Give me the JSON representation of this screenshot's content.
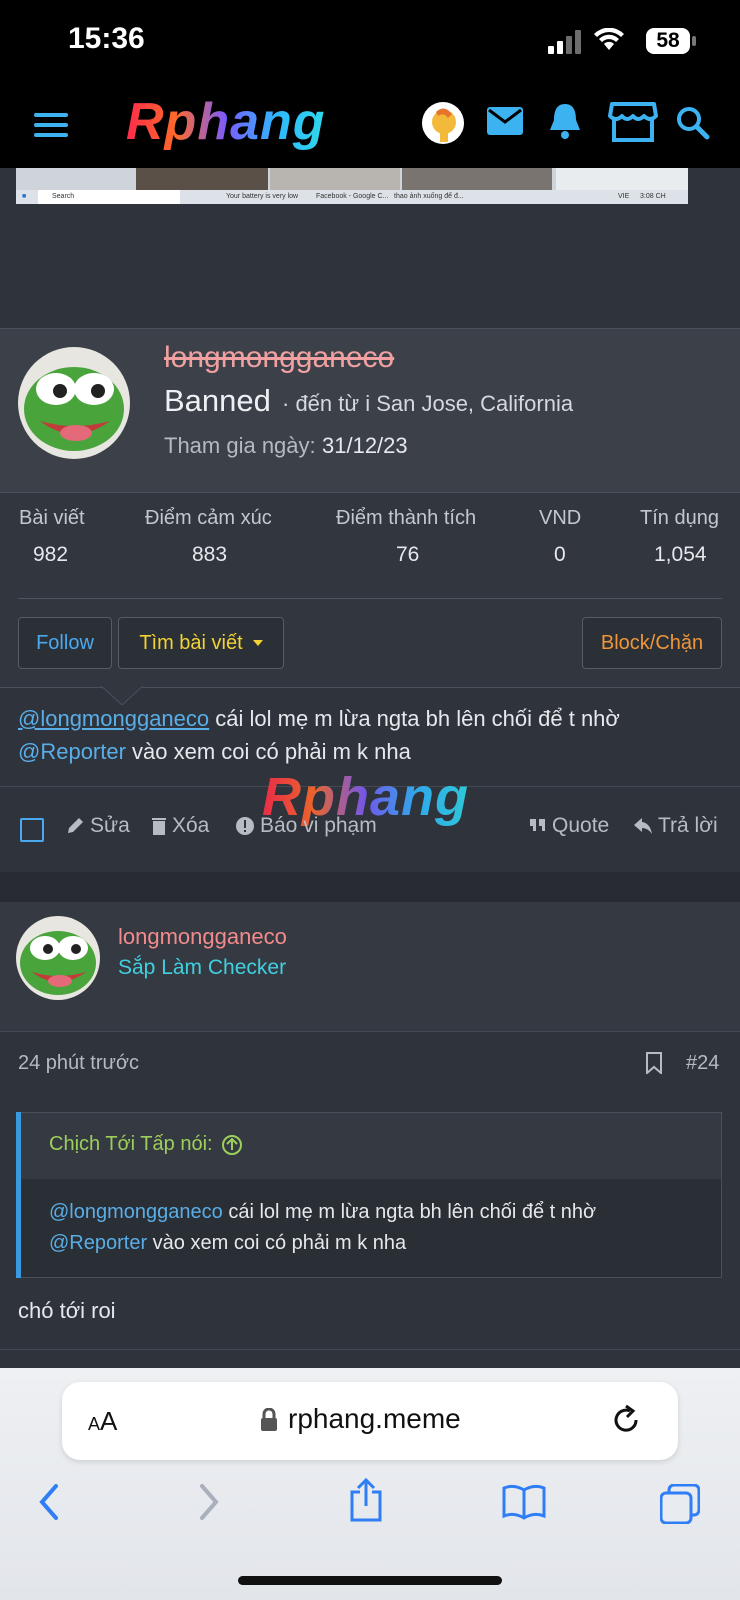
{
  "status": {
    "time": "15:36",
    "battery": "58"
  },
  "header": {
    "logo": "Rphang",
    "menu_icon": "menu-icon",
    "icons": [
      "avatar",
      "mail-icon",
      "bell-icon",
      "store-icon",
      "search-icon"
    ]
  },
  "screenshot_strip": {
    "search": "Search",
    "tab1": "Your battery is very low",
    "tab2": "Facebook - Google C...",
    "tab3": "thao ảnh xuống để đ...",
    "lang": "VIE",
    "time": "3:08 CH"
  },
  "profile": {
    "username": "longmongganeco",
    "status": "Banned",
    "location": "· đến từ i San Jose, California",
    "joined_label": "Tham gia ngày:",
    "joined_date": "31/12/23",
    "stats": [
      {
        "label": "Bài viết",
        "value": "982"
      },
      {
        "label": "Điểm cảm xúc",
        "value": "883"
      },
      {
        "label": "Điểm thành tích",
        "value": "76"
      },
      {
        "label": "VND",
        "value": "0"
      },
      {
        "label": "Tín dụng",
        "value": "1,054"
      }
    ],
    "follow_btn": "Follow",
    "find_posts_btn": "Tìm bài viết",
    "block_btn": "Block/Chặn"
  },
  "post1": {
    "mention1": "@longmongganeco",
    "text1": " cái lol mẹ m lừa ngta bh lên chối để t nhờ",
    "mention2": "@Reporter",
    "text2": " vào xem coi có phải m k nha",
    "watermark": "Rphang",
    "actions": {
      "edit": "Sửa",
      "delete": "Xóa",
      "report": "Báo vi phạm",
      "quote": "Quote",
      "reply": "Trả lời"
    }
  },
  "post2": {
    "username": "longmongganeco",
    "title": "Sắp Làm Checker",
    "time": "24 phút trước",
    "number": "#24",
    "quote_author": "Chịch Tới Tấp nói:",
    "quote_mention1": "@longmongganeco",
    "quote_text1": " cái lol mẹ m lừa ngta bh lên chối để t nhờ",
    "quote_mention2": "@Reporter",
    "quote_text2": " vào xem coi có phải m k nha",
    "body": "chó tới roi"
  },
  "browser": {
    "aa": "AA",
    "url": "rphang.meme"
  },
  "colors": {
    "accent": "#59aee8",
    "banned": "#f0a0a0",
    "username": "#f28b8b",
    "title": "#3fd0e0",
    "find": "#f3d234",
    "block": "#f0963a",
    "quote_author": "#9ccf5a"
  }
}
